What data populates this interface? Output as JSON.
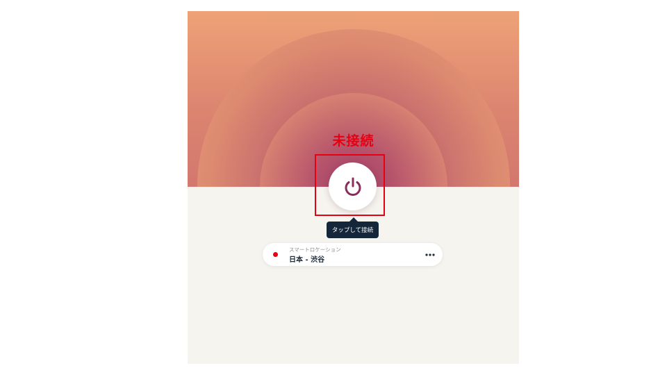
{
  "status": {
    "label": "未接続",
    "color": "#e60012"
  },
  "power_button": {
    "icon": "power-icon",
    "icon_color": "#8b2c5e"
  },
  "tooltip": {
    "text": "タップして接続"
  },
  "location": {
    "caption": "スマートロケーション",
    "name": "日本 - 渋谷",
    "status_dot_color": "#e60012",
    "more_icon": "more-horizontal-icon"
  },
  "colors": {
    "hero_top": "#eea277",
    "ring_center": "#a2406a",
    "background": "#f6f4ef",
    "tooltip_bg": "#13263a"
  }
}
